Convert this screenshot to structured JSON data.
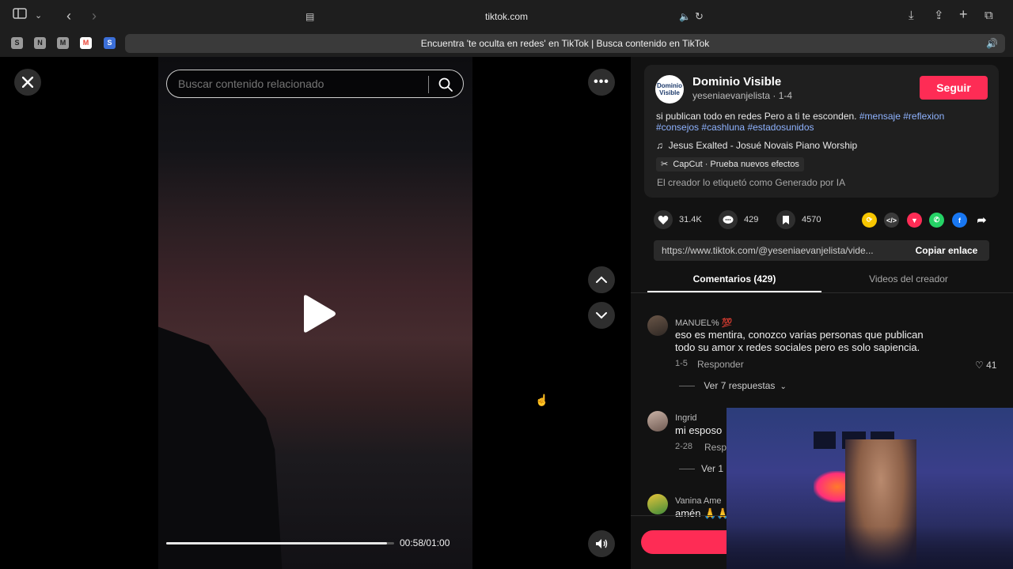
{
  "browser": {
    "url": "tiktok.com",
    "tab_title": "Encuentra 'te oculta en redes' en TikTok | Busca contenido en TikTok",
    "favicons": [
      "S",
      "N",
      "M",
      "M",
      "S"
    ]
  },
  "video": {
    "search_placeholder": "Buscar contenido relacionado",
    "time": "00:58/01:00",
    "progress_fraction": 0.97
  },
  "post": {
    "author_name": "Dominio Visible",
    "avatar_text": "Dominio Visible",
    "handle": "yeseniaevanjelista · 1-4",
    "follow_label": "Seguir",
    "description": "si publican todo en redes Pero a ti te esconden.",
    "hashtags": [
      "#mensaje",
      "#reflexion",
      "#consejos",
      "#cashluna",
      "#estadosunidos"
    ],
    "music": "Jesus Exalted - Josué Novais Piano Worship",
    "effect": "CapCut · Prueba nuevos efectos",
    "ai_label": "El creador lo etiquetó como Generado por IA",
    "likes": "31.4K",
    "comments": "429",
    "saves": "4570",
    "link": "https://www.tiktok.com/@yeseniaevanjelista/vide...",
    "copy_label": "Copiar enlace"
  },
  "tabs": {
    "comments_label": "Comentarios (429)",
    "videos_label": "Videos del creador"
  },
  "comments": [
    {
      "name": "MANUEL% 💯",
      "text": "eso es mentira, conozco varias personas que publican todo su amor x redes sociales pero es solo sapiencia.",
      "date": "1-5",
      "reply_label": "Responder",
      "likes": "41",
      "view_replies": "Ver 7 respuestas"
    },
    {
      "name": "Ingrid",
      "text": "mi esposo",
      "date": "2-28",
      "reply_label": "Resp",
      "view_replies": "Ver 1"
    },
    {
      "name": "Vanina Ame",
      "text": "amén 🙏🙏"
    }
  ],
  "colors": {
    "accent": "#fe2c55",
    "hashtag": "#8fb3ff",
    "panel": "#121212"
  }
}
